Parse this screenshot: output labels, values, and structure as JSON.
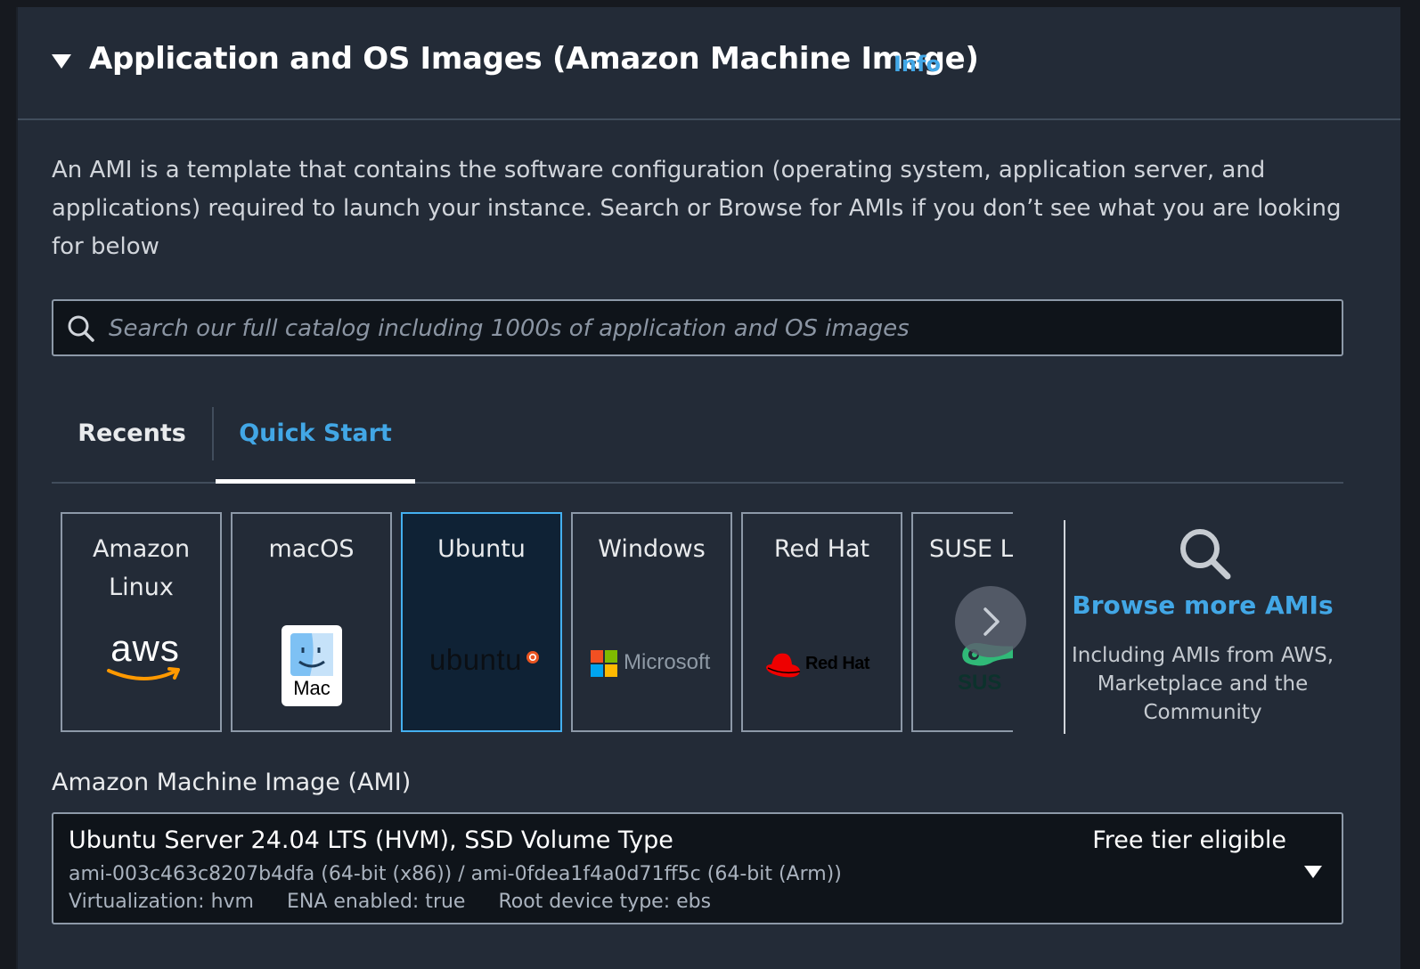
{
  "header": {
    "title": "Application and OS Images (Amazon Machine Image)",
    "info_link": "Info"
  },
  "description": "An AMI is a template that contains the software configuration (operating system, application server, and applications) required to launch your instance. Search or Browse for AMIs if you don’t see what you are looking for below",
  "search": {
    "placeholder": "Search our full catalog including 1000s of application and OS images",
    "value": ""
  },
  "tabs": [
    {
      "label": "Recents",
      "active": false
    },
    {
      "label": "Quick Start",
      "active": true
    }
  ],
  "os_tiles": [
    {
      "name": "Amazon Linux",
      "logo_text": "aws",
      "selected": false
    },
    {
      "name": "macOS",
      "logo_text": "Mac",
      "selected": false
    },
    {
      "name": "Ubuntu",
      "logo_text": "ubuntu",
      "selected": true
    },
    {
      "name": "Windows",
      "logo_text": "Microsoft",
      "selected": false
    },
    {
      "name": "Red Hat",
      "logo_text": "Red Hat",
      "selected": false
    },
    {
      "name": "SUSE Li",
      "logo_text": "SUS",
      "selected": false
    }
  ],
  "browse": {
    "link": "Browse more AMIs",
    "description": "Including AMIs from AWS, Marketplace and the Community"
  },
  "ami": {
    "label": "Amazon Machine Image (AMI)",
    "name": "Ubuntu Server 24.04 LTS (HVM), SSD Volume Type",
    "badge": "Free tier eligible",
    "ids": "ami-003c463c8207b4dfa (64-bit (x86)) / ami-0fdea1f4a0d71ff5c (64-bit (Arm))",
    "virtualization": "Virtualization: hvm",
    "ena": "ENA enabled: true",
    "root_device": "Root device type: ebs"
  },
  "colors": {
    "background": "#232b37",
    "link": "#42a7e6",
    "selected_border": "#44b0f0",
    "ubuntu_orange": "#e95420",
    "aws_orange": "#ff9900",
    "redhat_red": "#ee0000",
    "suse_green": "#30ba78"
  },
  "icons": [
    "caret-down-icon",
    "search-icon",
    "chevron-right-icon",
    "magnifier-icon",
    "dropdown-caret-icon"
  ]
}
